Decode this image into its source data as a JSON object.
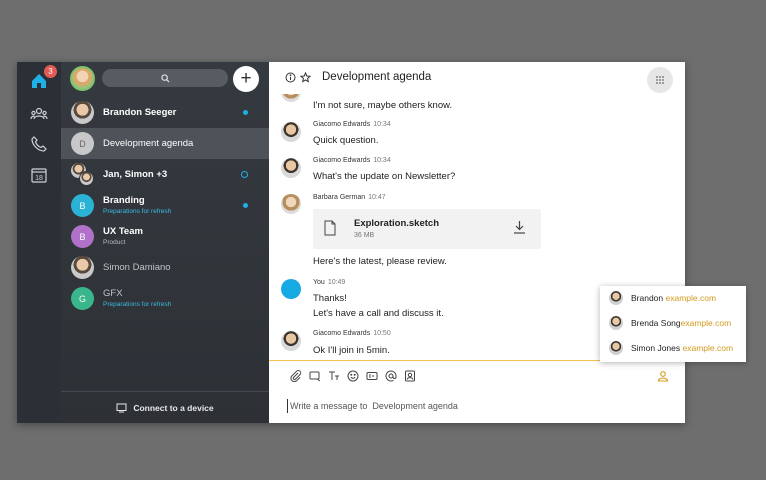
{
  "rail": {
    "notification_count": "3",
    "calendar_day": "18",
    "accent": "#1fb0e8",
    "badge_color": "#e35b56"
  },
  "conversations": [
    {
      "name": "Brandon Seeger",
      "sub": "",
      "avatar": "",
      "style": "bold",
      "indicator": "dot"
    },
    {
      "name": "Development agenda",
      "sub": "",
      "avatar": "D",
      "avatar_color": "#c8c8c8",
      "style": "normal",
      "indicator": "",
      "active": true
    },
    {
      "name": "Jan, Simon +3",
      "sub": "",
      "avatar": "",
      "style": "bold",
      "indicator": "ring"
    },
    {
      "name": "Branding",
      "sub": "Preparations for refresh",
      "avatar": "B",
      "avatar_color": "#2bb3d6",
      "sub_color": "#3bb9e0",
      "style": "bold",
      "indicator": "dot"
    },
    {
      "name": "UX Team",
      "sub": "Product",
      "avatar": "B",
      "avatar_color": "#b072c9",
      "sub_color": "#b8bcc1",
      "style": "bold",
      "indicator": ""
    },
    {
      "name": "Simon Damiano",
      "sub": "",
      "avatar": "",
      "style": "dim",
      "indicator": ""
    },
    {
      "name": "GFX",
      "sub": "Preparations for refresh",
      "avatar": "G",
      "avatar_color": "#39b68b",
      "sub_color": "#3bb9e0",
      "style": "dim",
      "indicator": ""
    }
  ],
  "connect_label": "Connect to a device",
  "chat": {
    "title": "Development agenda",
    "messages": [
      {
        "sender": "",
        "time": "",
        "lines": [
          "I'm not sure, maybe others know."
        ]
      },
      {
        "sender": "Giacomo Edwards",
        "time": "10:34",
        "lines": [
          "Quick question."
        ]
      },
      {
        "sender": "Giacomo Edwards",
        "time": "10:34",
        "lines": [
          "What's the update on Newsletter?"
        ]
      },
      {
        "sender": "Barbara German",
        "time": "10:47",
        "lines": [
          "Here's the latest, please review."
        ]
      },
      {
        "sender": "You",
        "time": "10:49",
        "lines": [
          "Thanks!",
          "Let's have a call and discuss it."
        ]
      },
      {
        "sender": "Giacomo Edwards",
        "time": "10:50",
        "lines": [
          "Ok I'll join in 5min."
        ]
      }
    ],
    "file": {
      "name": "Exploration.sketch",
      "size": "36 MB"
    },
    "input_placeholder": "Write a message to  Development agenda"
  },
  "mentions": [
    {
      "name": "Brandon",
      "domain": "example.com"
    },
    {
      "name": "Brenda Song",
      "domain": "example.com"
    },
    {
      "name": "Simon Jones",
      "domain": "example.com"
    }
  ]
}
